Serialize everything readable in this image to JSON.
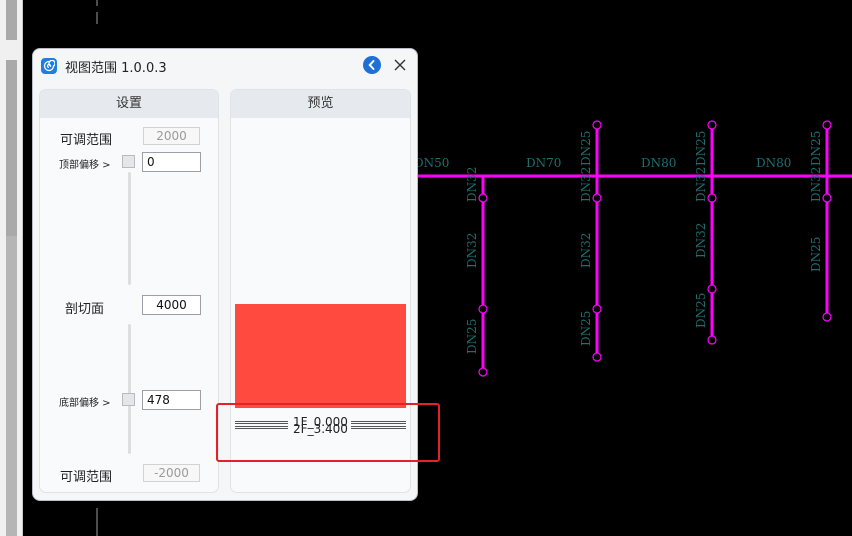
{
  "dialog": {
    "title": "视图范围 1.0.0.3",
    "settings_header": "设置",
    "preview_header": "预览",
    "top_range_label": "可调范围",
    "top_range_value": "2000",
    "top_offset_label": "顶部偏移 >",
    "top_offset_value": "0",
    "cut_plane_label": "剖切面",
    "cut_plane_value": "4000",
    "bottom_offset_label": "底部偏移 >",
    "bottom_offset_value": "478",
    "bottom_range_label": "可调范围",
    "bottom_range_value": "-2000",
    "level_1": "1F_0.000",
    "level_2": "2F_3.400"
  },
  "cad": {
    "pipe_labels": [
      "DN50",
      "DN70",
      "DN80",
      "DN80",
      "DN25",
      "DN25",
      "DN25",
      "DN32",
      "DN32",
      "DN32",
      "DN32",
      "DN32",
      "DN25",
      "DN25",
      "DN25",
      "DN25"
    ],
    "pipe_color": "#ff00ff",
    "label_color": "#1f6f6f"
  },
  "colors": {
    "accent": "#1f6fd6",
    "preview_fill": "#ff4a3f",
    "highlight": "#e3212a"
  }
}
